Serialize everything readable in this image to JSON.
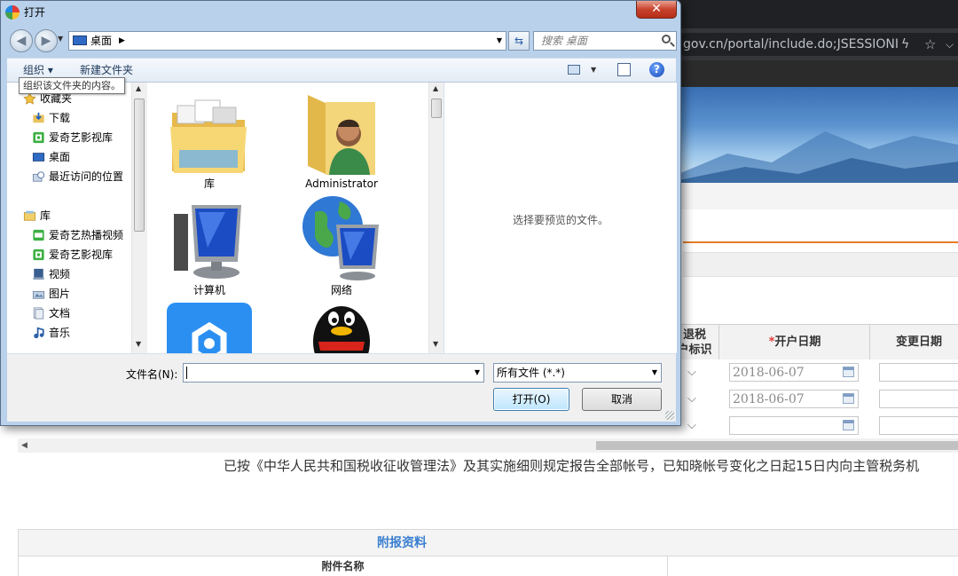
{
  "browser": {
    "url": "gov.cn/portal/include.do;JSESSIONI",
    "tabs": [
      "",
      "",
      "",
      ""
    ]
  },
  "page": {
    "table_headers": {
      "refund": "退税账户标识",
      "refund_line1": "退税",
      "refund_line2": "户标识",
      "open_date_req": "*",
      "open_date": "开户日期",
      "change_date": "变更日期"
    },
    "rows": [
      {
        "open_date": "2018-06-07"
      },
      {
        "open_date": "2018-06-07"
      },
      {
        "open_date": ""
      }
    ],
    "declaration": "已按《中华人民共和国税收征收管理法》及其实施细则规定报告全部帐号，已知晓帐号变化之日起15日内向主管税务机",
    "attachments_title": "附报资料",
    "attachment_name_header": "附件名称"
  },
  "dialog": {
    "title": "打开",
    "close_label": "✕",
    "path": "桌面",
    "search_placeholder": "搜索 桌面",
    "organize_label": "组织 ▾",
    "new_folder_label": "新建文件夹",
    "tooltip": "组织该文件夹的内容。",
    "nav_items": [
      {
        "label": "收藏夹",
        "icon": "star-icon",
        "indent": 0
      },
      {
        "label": "下载",
        "icon": "download-folder-icon",
        "indent": 1
      },
      {
        "label": "爱奇艺影视库",
        "icon": "iqiyi-icon",
        "indent": 1
      },
      {
        "label": "桌面",
        "icon": "desktop-icon",
        "indent": 1
      },
      {
        "label": "最近访问的位置",
        "icon": "recent-places-icon",
        "indent": 1
      },
      {
        "label": "库",
        "icon": "library-icon",
        "indent": 0
      },
      {
        "label": "爱奇艺热播视频",
        "icon": "iqiyi-hot-icon",
        "indent": 1
      },
      {
        "label": "爱奇艺影视库",
        "icon": "iqiyi-icon",
        "indent": 1
      },
      {
        "label": "视频",
        "icon": "video-library-icon",
        "indent": 1
      },
      {
        "label": "图片",
        "icon": "pictures-library-icon",
        "indent": 1
      },
      {
        "label": "文档",
        "icon": "documents-library-icon",
        "indent": 1
      },
      {
        "label": "音乐",
        "icon": "music-library-icon",
        "indent": 1
      }
    ],
    "files": [
      {
        "label": "库",
        "icon": "libraries-folder-icon"
      },
      {
        "label": "Administrator",
        "icon": "user-folder-icon"
      },
      {
        "label": "计算机",
        "icon": "computer-icon"
      },
      {
        "label": "网络",
        "icon": "network-icon"
      },
      {
        "label": "",
        "icon": "app-settings-icon"
      },
      {
        "label": "",
        "icon": "qq-penguin-icon"
      }
    ],
    "preview_text": "选择要预览的文件。",
    "filename_label": "文件名(N):",
    "filename_value": "",
    "filetype_value": "所有文件 (*.*)",
    "open_button": "打开(O)",
    "cancel_button": "取消"
  }
}
